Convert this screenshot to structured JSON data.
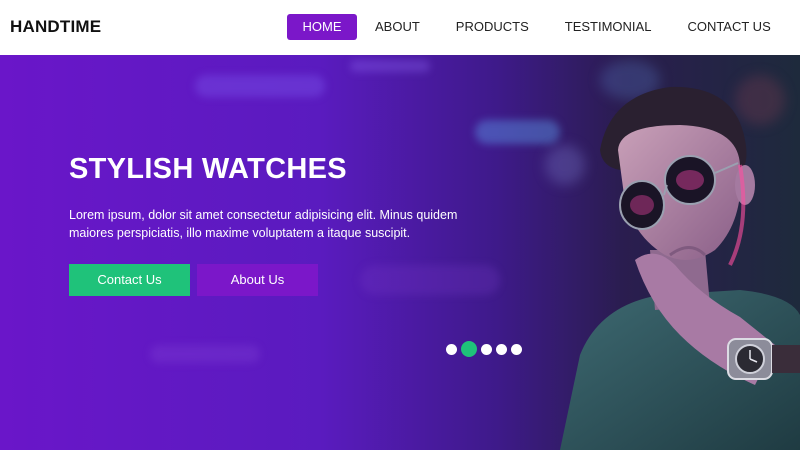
{
  "brand": {
    "logo": "HANDTIME"
  },
  "nav": {
    "items": [
      {
        "label": "HOME",
        "active": true
      },
      {
        "label": "ABOUT",
        "active": false
      },
      {
        "label": "PRODUCTS",
        "active": false
      },
      {
        "label": "TESTIMONIAL",
        "active": false
      },
      {
        "label": "CONTACT US",
        "active": false
      }
    ]
  },
  "hero": {
    "title": "STYLISH WATCHES",
    "description": "Lorem ipsum, dolor sit amet consectetur adipisicing elit. Minus quidem maiores perspiciatis, illo maxime voluptatem a itaque suscipit.",
    "primary_button": "Contact Us",
    "secondary_button": "About Us"
  },
  "carousel": {
    "slide_count": 5,
    "active_index": 1
  },
  "colors": {
    "accent_purple": "#7b17c9",
    "accent_green": "#1fc27a",
    "text_dark": "#111111"
  }
}
